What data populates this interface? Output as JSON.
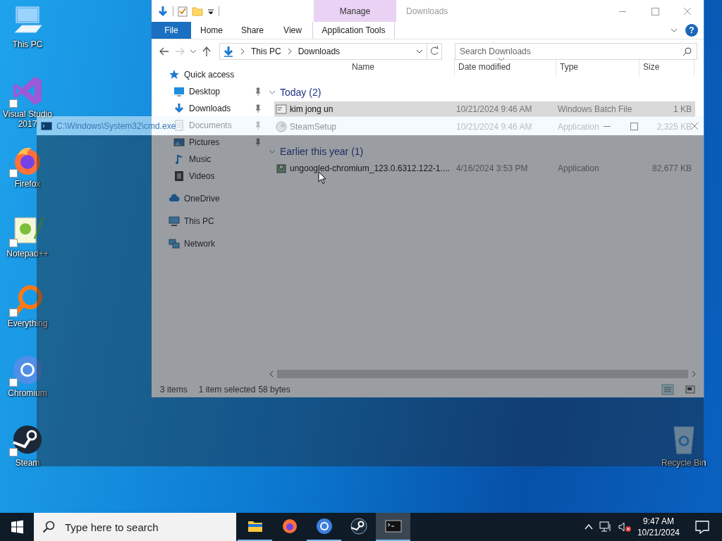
{
  "desktop_icons": [
    {
      "label": "This PC",
      "kind": "pc"
    },
    {
      "label": "Visual Studio 2017",
      "kind": "vs"
    },
    {
      "label": "Firefox",
      "kind": "firefox"
    },
    {
      "label": "Notepad++",
      "kind": "notepad"
    },
    {
      "label": "Everything",
      "kind": "everything"
    },
    {
      "label": "Chromium",
      "kind": "chromium"
    },
    {
      "label": "Steam",
      "kind": "steam"
    },
    {
      "label": "Recycle Bin",
      "kind": "bin"
    }
  ],
  "explorer": {
    "title": "Downloads",
    "context_group": "Manage",
    "ribbon_tabs": [
      {
        "label": "File",
        "kind": "file"
      },
      {
        "label": "Home",
        "kind": "plain"
      },
      {
        "label": "Share",
        "kind": "plain"
      },
      {
        "label": "View",
        "kind": "plain"
      },
      {
        "label": "Application Tools",
        "kind": "context"
      }
    ],
    "help": "?",
    "address": [
      "This PC",
      "Downloads"
    ],
    "search": {
      "placeholder": "Search Downloads"
    },
    "nav": [
      {
        "label": "Quick access",
        "kind": "star",
        "children": [
          {
            "label": "Desktop",
            "kind": "desktop",
            "pinned": true
          },
          {
            "label": "Downloads",
            "kind": "download",
            "pinned": true
          },
          {
            "label": "Documents",
            "kind": "documents",
            "pinned": true
          },
          {
            "label": "Pictures",
            "kind": "pictures",
            "pinned": true
          },
          {
            "label": "Music",
            "kind": "music",
            "pinned": false
          },
          {
            "label": "Videos",
            "kind": "videos",
            "pinned": false
          }
        ]
      },
      {
        "label": "OneDrive",
        "kind": "cloud"
      },
      {
        "label": "This PC",
        "kind": "pc"
      },
      {
        "label": "Network",
        "kind": "network"
      }
    ],
    "columns": [
      {
        "label": "Name",
        "sorted": false
      },
      {
        "label": "Date modified",
        "sorted": true
      },
      {
        "label": "Type",
        "sorted": false
      },
      {
        "label": "Size",
        "sorted": false
      }
    ],
    "groups": [
      {
        "title": "Today (2)",
        "expanded": true,
        "files": [
          {
            "name": "kim jong un",
            "date": "10/21/2024 9:46 AM",
            "type": "Windows Batch File",
            "size": "1 KB",
            "kind": "batch",
            "selected": true
          },
          {
            "name": "SteamSetup",
            "date": "10/21/2024 9:46 AM",
            "type": "Application",
            "size": "2,325 KB",
            "kind": "steam",
            "selected": false
          }
        ]
      },
      {
        "title": "Earlier this year (1)",
        "expanded": true,
        "files": [
          {
            "name": "ungoogled-chromium_123.0.6312.122-1....",
            "date": "4/16/2024 3:53 PM",
            "type": "Application",
            "size": "82,677 KB",
            "kind": "installer",
            "selected": false
          }
        ]
      }
    ],
    "status": [
      "3 items",
      "1 item selected",
      "58 bytes"
    ]
  },
  "cmd_window": {
    "title": "C:\\Windows\\System32\\cmd.exe"
  },
  "taskbar": {
    "search": {
      "placeholder": "Type here to search"
    },
    "apps": [
      {
        "kind": "explorer",
        "running": true,
        "active": false
      },
      {
        "kind": "firefox",
        "running": false,
        "active": false
      },
      {
        "kind": "chromium",
        "running": true,
        "active": false
      },
      {
        "kind": "steam",
        "running": false,
        "active": false
      },
      {
        "kind": "cmd",
        "running": true,
        "active": true
      }
    ],
    "time": "9:47 AM",
    "date": "10/21/2024"
  }
}
